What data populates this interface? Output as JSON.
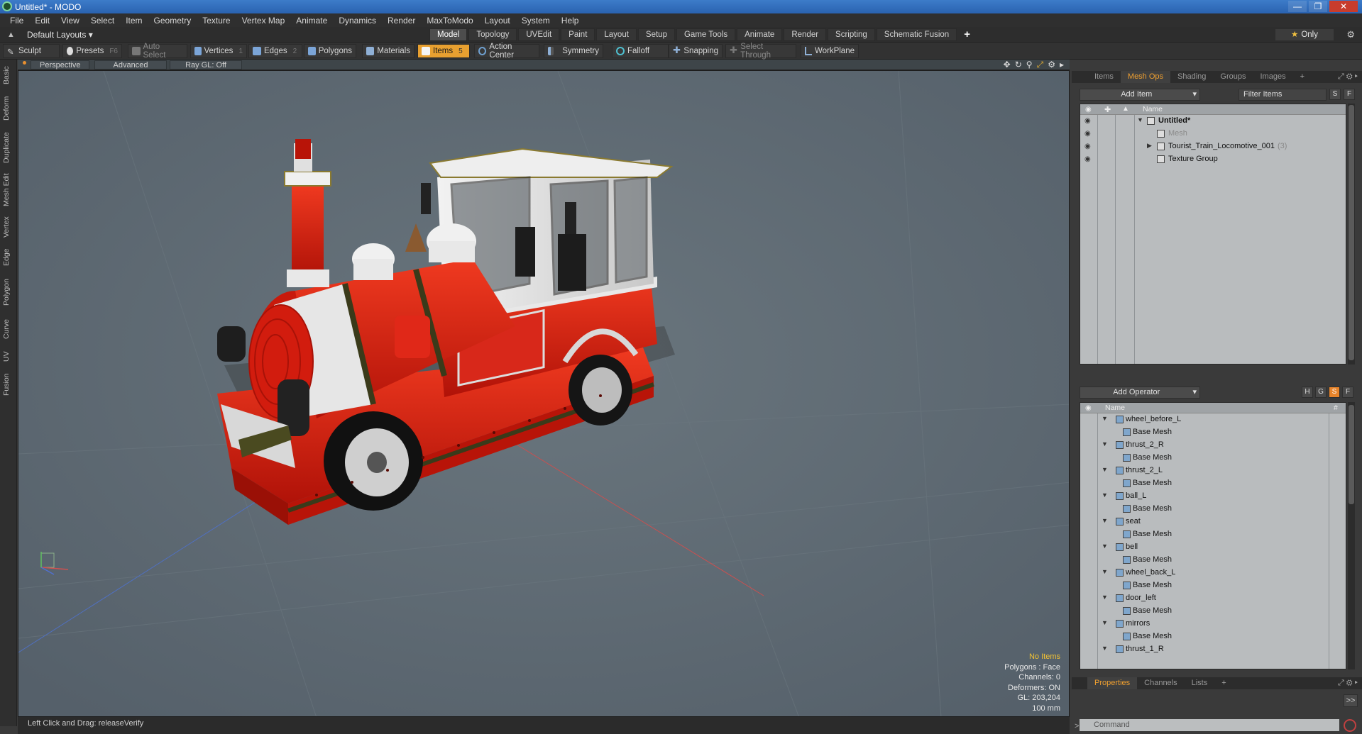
{
  "window": {
    "title": "Untitled* - MODO"
  },
  "menu": [
    "File",
    "Edit",
    "View",
    "Select",
    "Item",
    "Geometry",
    "Texture",
    "Vertex Map",
    "Animate",
    "Dynamics",
    "Render",
    "MaxToModo",
    "Layout",
    "System",
    "Help"
  ],
  "layouts_label": "Default Layouts",
  "layout_tabs": [
    {
      "label": "Model",
      "active": true
    },
    {
      "label": "Topology",
      "active": false
    },
    {
      "label": "UVEdit",
      "active": false
    },
    {
      "label": "Paint",
      "active": false
    },
    {
      "label": "Layout",
      "active": false
    },
    {
      "label": "Setup",
      "active": false
    },
    {
      "label": "Game Tools",
      "active": false
    },
    {
      "label": "Animate",
      "active": false
    },
    {
      "label": "Render",
      "active": false
    },
    {
      "label": "Scripting",
      "active": false
    },
    {
      "label": "Schematic Fusion",
      "active": false
    }
  ],
  "only_label": "Only",
  "toolbar": {
    "sculpt": "Sculpt",
    "presets": "Presets",
    "presets_key": "F6",
    "auto_select": "Auto Select",
    "vertices": "Vertices",
    "vertices_key": "1",
    "edges": "Edges",
    "edges_key": "2",
    "polygons": "Polygons",
    "materials": "Materials",
    "items": "Items",
    "items_key": "5",
    "action_center": "Action Center",
    "symmetry": "Symmetry",
    "falloff": "Falloff",
    "snapping": "Snapping",
    "select_through": "Select Through",
    "workplane": "WorkPlane"
  },
  "left_tabs": [
    "Basic",
    "Deform",
    "Duplicate",
    "Mesh Edit",
    "Vertex",
    "Edge",
    "Polygon",
    "Curve",
    "UV",
    "Fusion"
  ],
  "viewport": {
    "view": "Perspective",
    "mode": "Advanced",
    "raygl": "Ray GL: Off",
    "hud": {
      "no_items": "No Items",
      "polygons": "Polygons : Face",
      "channels": "Channels: 0",
      "deformers": "Deformers: ON",
      "gl": "GL: 203,204",
      "scale": "100 mm"
    }
  },
  "status": "Left Click and Drag:  releaseVerify",
  "colors": {
    "accent": "#e8a030",
    "viewport_bg": "#5d6870",
    "train_red": "#d41c10"
  },
  "items_panel": {
    "tabs": [
      {
        "label": "Items",
        "active": false
      },
      {
        "label": "Mesh Ops",
        "active": true
      },
      {
        "label": "Shading",
        "active": false
      },
      {
        "label": "Groups",
        "active": false
      },
      {
        "label": "Images",
        "active": false
      },
      {
        "label": "+",
        "active": false
      }
    ],
    "add_item": "Add Item",
    "filter": "Filter Items",
    "header_name": "Name",
    "rows": [
      {
        "label": "Untitled*",
        "indent": 0,
        "style": "bold",
        "count": ""
      },
      {
        "label": "Mesh",
        "indent": 1,
        "style": "dim",
        "count": ""
      },
      {
        "label": "Tourist_Train_Locomotive_001",
        "indent": 1,
        "style": "normal",
        "count": "(3)"
      },
      {
        "label": "Texture Group",
        "indent": 1,
        "style": "normal",
        "count": ""
      }
    ]
  },
  "meshops_panel": {
    "add_operator": "Add Operator",
    "header_name": "Name",
    "header_hash": "#",
    "rows": [
      {
        "label": "wheel_before_L",
        "level": 0
      },
      {
        "label": "Base Mesh",
        "level": 1
      },
      {
        "label": "thrust_2_R",
        "level": 0
      },
      {
        "label": "Base Mesh",
        "level": 1
      },
      {
        "label": "thrust_2_L",
        "level": 0
      },
      {
        "label": "Base Mesh",
        "level": 1
      },
      {
        "label": "ball_L",
        "level": 0
      },
      {
        "label": "Base Mesh",
        "level": 1
      },
      {
        "label": "seat",
        "level": 0
      },
      {
        "label": "Base Mesh",
        "level": 1
      },
      {
        "label": "bell",
        "level": 0
      },
      {
        "label": "Base Mesh",
        "level": 1
      },
      {
        "label": "wheel_back_L",
        "level": 0
      },
      {
        "label": "Base Mesh",
        "level": 1
      },
      {
        "label": "door_left",
        "level": 0
      },
      {
        "label": "Base Mesh",
        "level": 1
      },
      {
        "label": "mirrors",
        "level": 0
      },
      {
        "label": "Base Mesh",
        "level": 1
      },
      {
        "label": "thrust_1_R",
        "level": 0
      }
    ]
  },
  "props_panel": {
    "tabs": [
      {
        "label": "Properties",
        "active": true
      },
      {
        "label": "Channels",
        "active": false
      },
      {
        "label": "Lists",
        "active": false
      },
      {
        "label": "+",
        "active": false
      }
    ]
  },
  "command_placeholder": "Command"
}
